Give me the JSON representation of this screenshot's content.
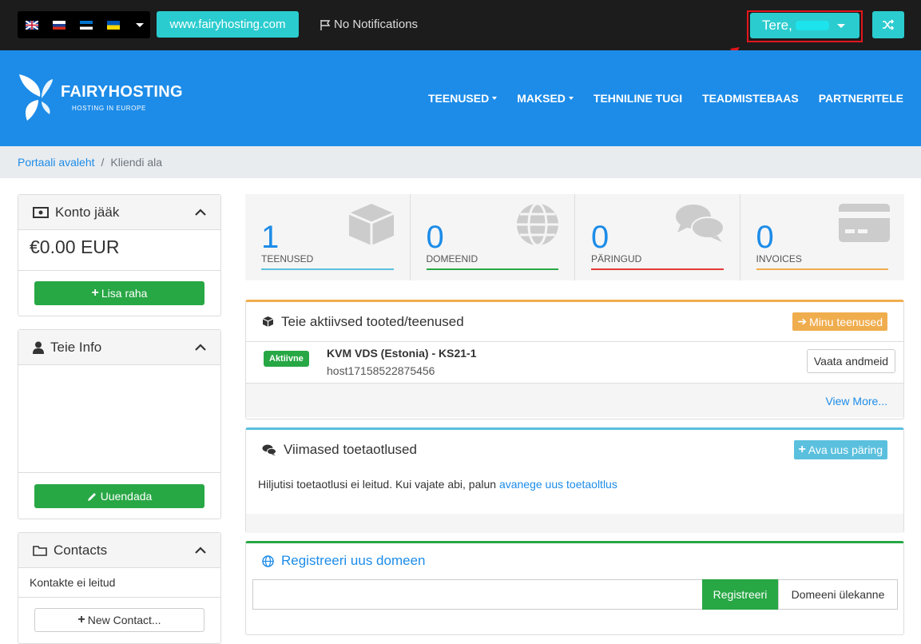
{
  "topbar": {
    "site_label": "www.fairyhosting.com",
    "notifications": "No Notifications",
    "greeting": "Tere,",
    "flags": [
      "flag-uk",
      "flag-ru",
      "flag-ee",
      "flag-ua"
    ],
    "accent": "#2bcccf"
  },
  "header": {
    "brand": "FAIRYHOSTING",
    "tagline": "HOSTING IN EUROPE",
    "nav": [
      "TEENUSED",
      "MAKSED",
      "TEHNILINE TUGI",
      "TEADMISTEBAAS",
      "PARTNERITELE"
    ],
    "bg": "#1d8ce8"
  },
  "breadcrumb": {
    "home": "Portaali avaleht",
    "current": "Kliendi ala"
  },
  "sidebar": {
    "balance": {
      "title": "Konto jääk",
      "amount": "€0.00 EUR",
      "button": "Lisa raha"
    },
    "info": {
      "title": "Teie Info",
      "button": "Uuendada"
    },
    "contacts": {
      "title": "Contacts",
      "empty": "Kontakte ei leitud",
      "button": "New Contact..."
    }
  },
  "stats": [
    {
      "num": "1",
      "label": "TEENUSED",
      "color": "#5bc0de",
      "icon": "cube-icon"
    },
    {
      "num": "0",
      "label": "DOMEENID",
      "color": "#28a745",
      "icon": "globe-icon"
    },
    {
      "num": "0",
      "label": "PÄRINGUD",
      "color": "#e53935",
      "icon": "comments-icon"
    },
    {
      "num": "0",
      "label": "INVOICES",
      "color": "#f0ad4e",
      "icon": "credit-card-icon"
    }
  ],
  "services": {
    "title": "Teie aktiivsed tooted/teenused",
    "button": "Minu teenused",
    "status": "Aktiivne",
    "name": "KVM VDS (Estonia) - KS21-1",
    "host": "host17158522875456",
    "view": "Vaata andmeid",
    "more": "View More..."
  },
  "tickets": {
    "title": "Viimased toetaotlused",
    "button": "Ava uus päring",
    "text": "Hiljutisi toetaotlusi ei leitud. Kui vajate abi, palun ",
    "link": "avanege uus toetaoltlus"
  },
  "domain": {
    "title": "Registreeri uus domeen",
    "register": "Registreeri",
    "transfer": "Domeeni ülekanne"
  }
}
